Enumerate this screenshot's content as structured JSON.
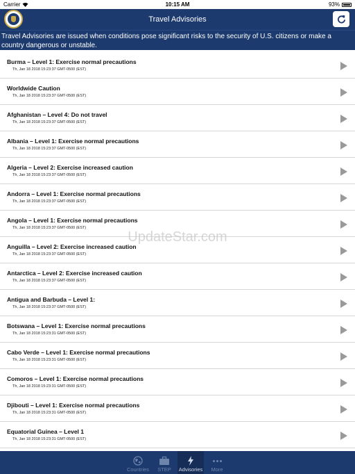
{
  "status_bar": {
    "carrier": "Carrier",
    "time": "10:15 AM",
    "battery": "93%"
  },
  "nav": {
    "title": "Travel Advisories",
    "refresh_icon": "refresh-icon",
    "logo_icon": "state-department-seal"
  },
  "banner": {
    "text": "Travel Advisories are issued when conditions pose significant risks to the security of U.S. citizens or make a country dangerous or unstable."
  },
  "advisories": [
    {
      "title": "Burma – Level 1: Exercise normal precautions",
      "date": "Th, Jan 18 2018 15:23:37 GMT-0500 (EST)"
    },
    {
      "title": "Worldwide Caution",
      "date": "Th, Jan 18 2018 15:23:37 GMT-0500 (EST)"
    },
    {
      "title": "Afghanistan – Level 4: Do not travel",
      "date": "Th, Jan 18 2018 15:23:37 GMT-0500 (EST)"
    },
    {
      "title": "Albania – Level 1: Exercise normal precautions",
      "date": "Th, Jan 18 2018 15:23:37 GMT-0500 (EST)"
    },
    {
      "title": "Algeria – Level 2: Exercise increased caution",
      "date": "Th, Jan 18 2018 15:23:37 GMT-0500 (EST)"
    },
    {
      "title": "Andorra – Level 1: Exercise normal precautions",
      "date": "Th, Jan 18 2018 15:23:37 GMT-0500 (EST)"
    },
    {
      "title": "Angola – Level 1: Exercise normal precautions",
      "date": "Th, Jan 18 2018 15:23:37 GMT-0500 (EST)"
    },
    {
      "title": "Anguilla – Level 2: Exercise increased caution",
      "date": "Th, Jan 18 2018 15:23:37 GMT-0500 (EST)"
    },
    {
      "title": "Antarctica – Level 2: Exercise increased caution",
      "date": "Th, Jan 18 2018 15:23:37 GMT-0500 (EST)"
    },
    {
      "title": "Antigua and Barbuda – Level 1:",
      "date": "Th, Jan 18 2018 15:23:37 GMT-0500 (EST)"
    },
    {
      "title": "Botswana – Level 1: Exercise normal precautions",
      "date": "Th, Jan 18 2018 15:23:31 GMT-0500 (EST)"
    },
    {
      "title": "Cabo Verde – Level 1: Exercise normal precautions",
      "date": "Th, Jan 18 2018 15:23:31 GMT-0500 (EST)"
    },
    {
      "title": "Comoros – Level 1: Exercise normal precautions",
      "date": "Th, Jan 18 2018 15:23:31 GMT-0500 (EST)"
    },
    {
      "title": "Djibouti – Level 1: Exercise normal precautions",
      "date": "Th, Jan 18 2018 15:23:31 GMT-0500 (EST)"
    },
    {
      "title": "Equatorial Guinea – Level 1",
      "date": "Th, Jan 18 2018 15:23:31 GMT-0500 (EST)"
    }
  ],
  "watermark": "UpdateStar.com",
  "tabs": [
    {
      "label": "Countries",
      "icon": "globe-icon",
      "active": false
    },
    {
      "label": "STEP",
      "icon": "briefcase-icon",
      "active": false
    },
    {
      "label": "Advisories",
      "icon": "lightning-icon",
      "active": true
    },
    {
      "label": "More",
      "icon": "more-dots-icon",
      "active": false
    }
  ],
  "colors": {
    "nav_background": "#1c3a6e",
    "arrow": "#9a9a9a",
    "tab_inactive": "#6d84ad"
  }
}
